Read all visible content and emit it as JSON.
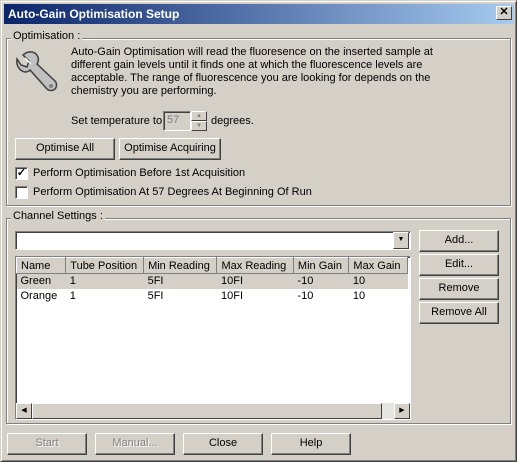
{
  "window": {
    "title": "Auto-Gain Optimisation Setup",
    "close_glyph": "✕"
  },
  "optimisation": {
    "group_label": "Optimisation :",
    "icon": "wrench-icon",
    "description_lines": [
      "Auto-Gain Optimisation will read the fluoresence on the inserted sample at",
      "different gain levels until it finds one at which the fluorescence levels are",
      "acceptable. The range of fluorescence you are looking for depends on the",
      "chemistry you are performing."
    ],
    "temperature_label": "Set temperature to",
    "temperature_value": "57",
    "temperature_unit": "degrees.",
    "optimise_all_label": "Optimise All",
    "optimise_acquiring_label": "Optimise Acquiring",
    "checkbox_before_label": "Perform Optimisation Before 1st Acquisition",
    "checkbox_before_checked": true,
    "checkbox_at57_label": "Perform Optimisation At 57 Degrees At Beginning Of Run",
    "checkbox_at57_checked": false
  },
  "channel_settings": {
    "group_label": "Channel Settings :",
    "dropdown_value": "",
    "columns": [
      "Name",
      "Tube Position",
      "Min Reading",
      "Max Reading",
      "Min Gain",
      "Max Gain"
    ],
    "rows": [
      [
        "Green",
        "1",
        "5FI",
        "10FI",
        "-10",
        "10"
      ],
      [
        "Orange",
        "1",
        "5FI",
        "10FI",
        "-10",
        "10"
      ]
    ],
    "add_label": "Add...",
    "edit_label": "Edit...",
    "remove_label": "Remove",
    "remove_all_label": "Remove All"
  },
  "footer": {
    "start_label": "Start",
    "manual_label": "Manual...",
    "close_label": "Close",
    "help_label": "Help"
  }
}
